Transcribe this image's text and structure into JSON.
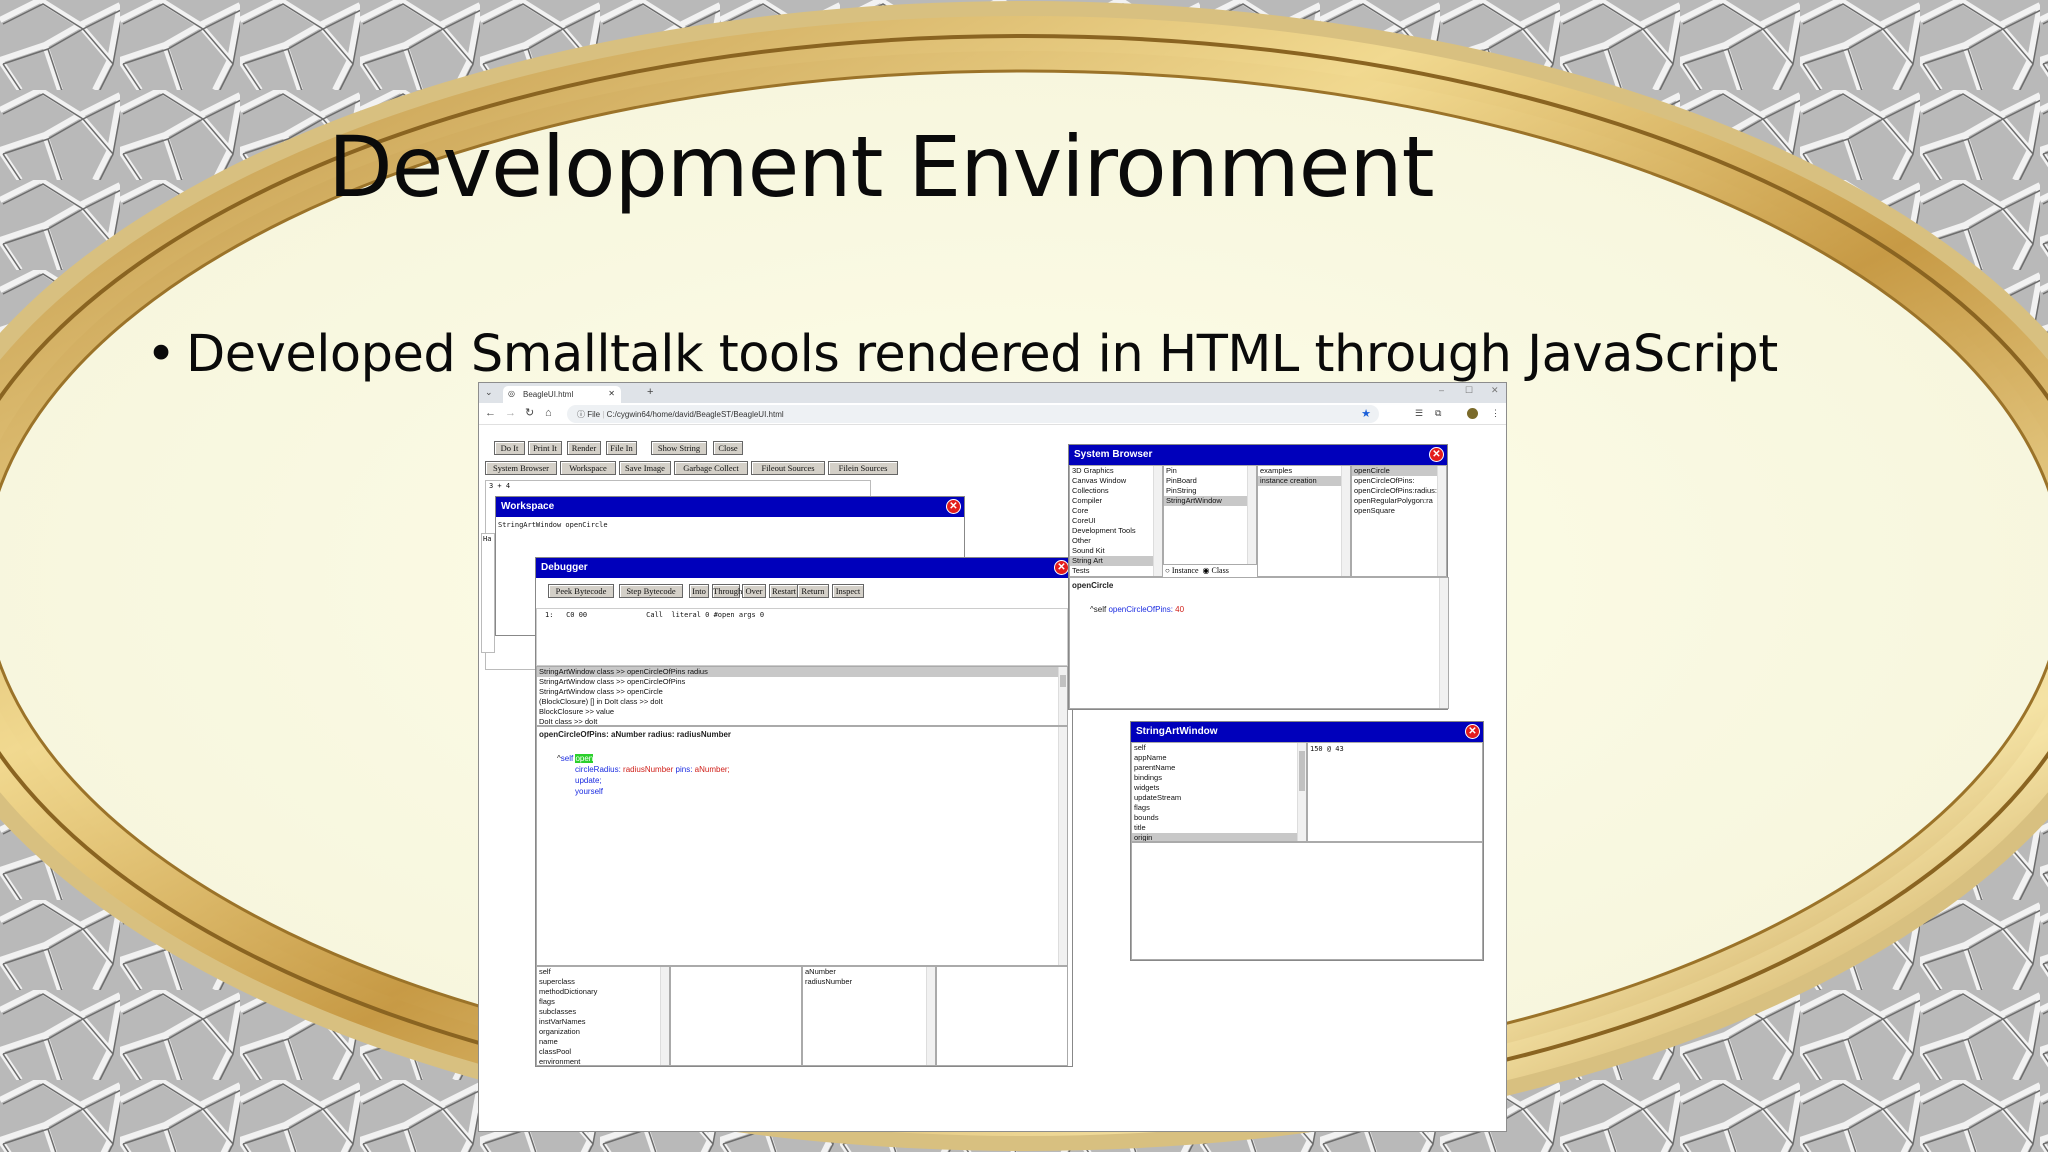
{
  "slide": {
    "title": "Development Environment",
    "bullet": "Developed Smalltalk tools rendered in HTML through JavaScript"
  },
  "browser": {
    "tab_title": "BeagleUI.html",
    "address_prefix": "File",
    "address": "C:/cygwin64/home/david/BeagleST/BeagleUI.html"
  },
  "toolbar": {
    "row1": [
      "Do It",
      "Print It",
      "Render",
      "File In",
      "Show String",
      "Close"
    ],
    "row2": [
      "System Browser",
      "Workspace",
      "Save Image",
      "Garbage Collect",
      "Fileout Sources",
      "Filein Sources"
    ]
  },
  "background_eval": "3 + 4",
  "background_status": "Ha",
  "workspace": {
    "title": "Workspace",
    "text": "StringArtWindow openCircle"
  },
  "debugger": {
    "title": "Debugger",
    "buttons": [
      "Peek Bytecode",
      "Step Bytecode",
      "Into",
      "Through",
      "Over",
      "Restart",
      "Return",
      "Inspect"
    ],
    "bytecode_line": "1:   C0 00              Call  literal 0 #open args 0",
    "stack": [
      "StringArtWindow class >> openCircleOfPins radius",
      "StringArtWindow class >> openCircleOfPins",
      "StringArtWindow class >> openCircle",
      "(BlockClosure) [] in DoIt class >> doIt",
      "BlockClosure >> value",
      "DoIt class >> doIt"
    ],
    "method_header": "openCircleOfPins: aNumber radius: radiusNumber",
    "code": {
      "caret": "^",
      "self": "self",
      "open": "open",
      "line2_sel": "circleRadius:",
      "line2_arg": "radiusNumber",
      "line2_sel2": "pins:",
      "line2_arg2": "aNumber;",
      "line3": "update;",
      "line4": "yourself"
    },
    "receiver_vars": [
      "self",
      "superclass",
      "methodDictionary",
      "flags",
      "subclasses",
      "instVarNames",
      "organization",
      "name",
      "classPool",
      "environment"
    ],
    "temp_vars": [
      "aNumber",
      "radiusNumber"
    ]
  },
  "system_browser": {
    "title": "System Browser",
    "categories": [
      "3D Graphics",
      "Canvas Window",
      "Collections",
      "Compiler",
      "Core",
      "CoreUI",
      "Development Tools",
      "Other",
      "Sound Kit",
      "String Art",
      "Tests"
    ],
    "classes": [
      "Pin",
      "PinBoard",
      "PinString",
      "StringArtWindow"
    ],
    "protocols": [
      "examples",
      "instance creation"
    ],
    "methods": [
      "openCircle",
      "openCircleOfPins:",
      "openCircleOfPins:radius:",
      "openRegularPolygon:ra",
      "openSquare"
    ],
    "radio_instance": "Instance",
    "radio_class": "Class",
    "method_header": "openCircle",
    "code_caret": "^self",
    "code_sel": "openCircleOfPins:",
    "code_num": "40"
  },
  "inspector": {
    "title": "StringArtWindow",
    "fields": [
      "self",
      "appName",
      "parentName",
      "bindings",
      "widgets",
      "updateStream",
      "flags",
      "bounds",
      "title",
      "origin"
    ],
    "value": "150 @ 43"
  }
}
